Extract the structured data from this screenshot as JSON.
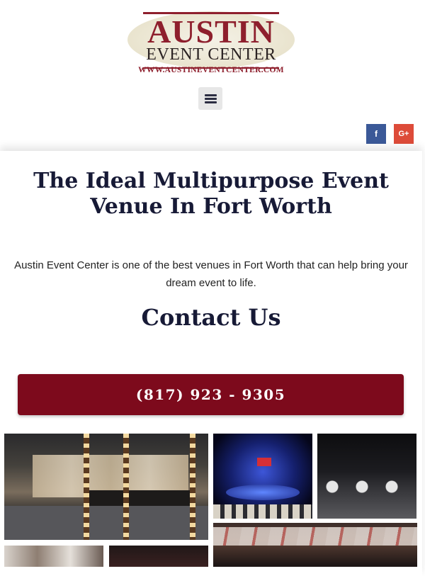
{
  "header": {
    "logo": {
      "main": "AUSTIN",
      "sub": "EVENT CENTER",
      "url": "WWW.AUSTINEVENTCENTER.COM"
    },
    "menu_icon": "hamburger-menu-icon",
    "social": [
      {
        "name": "facebook",
        "label": "f",
        "color": "#3b5998"
      },
      {
        "name": "google-plus",
        "label": "G+",
        "color": "#dd4b39"
      }
    ]
  },
  "main": {
    "headline": "The Ideal Multipurpose Event Venue In Fort Worth",
    "intro": "Austin Event Center is one of the best venues in Fort Worth that can help bring your dream event to life.",
    "contact_title": "Contact Us",
    "phone": "(817) 923 - 9305"
  },
  "colors": {
    "brand": "#7d0a1c",
    "heading": "#171a36"
  }
}
